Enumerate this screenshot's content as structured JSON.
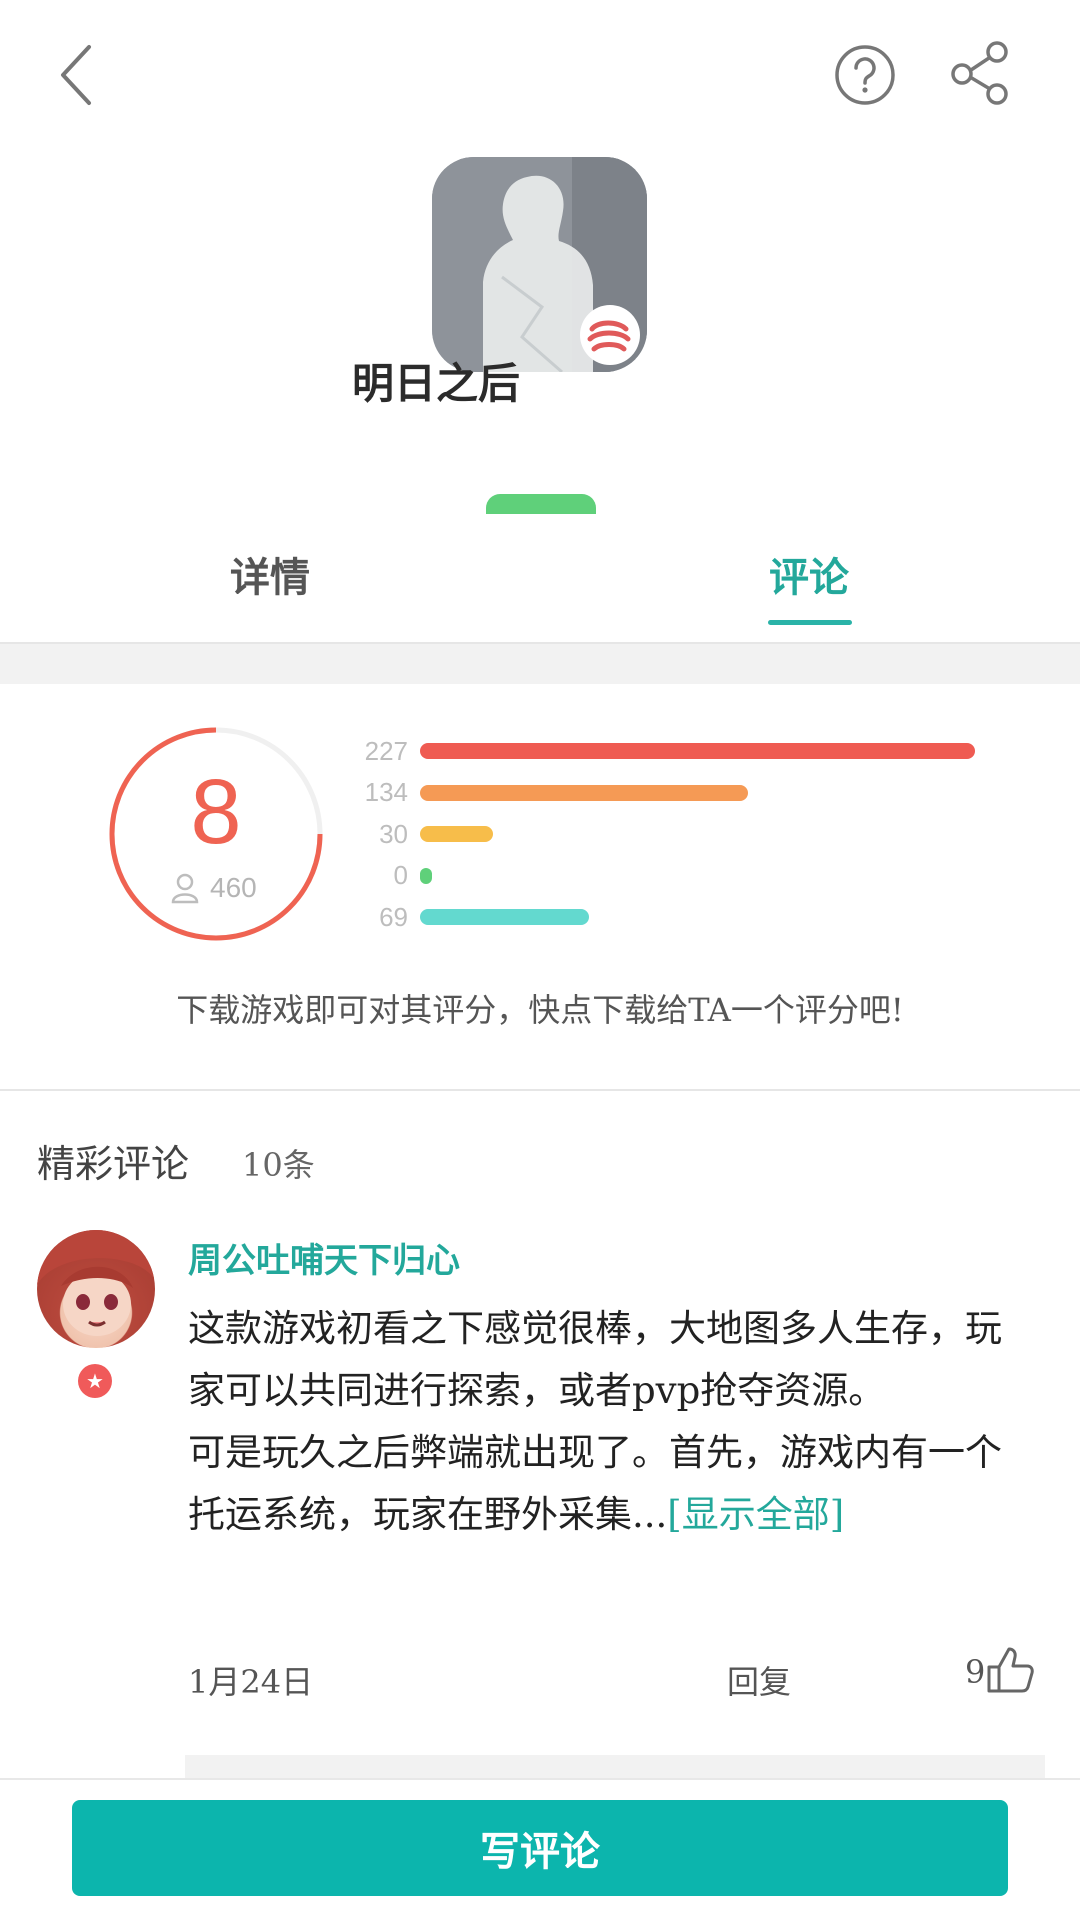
{
  "app": {
    "name": "明日之后"
  },
  "tabs": [
    {
      "label": "详情",
      "active": false
    },
    {
      "label": "评论",
      "active": true
    }
  ],
  "rating": {
    "score": "8",
    "raters": "460",
    "distribution": [
      {
        "count": "227",
        "value": 227,
        "color": "#ef5b52"
      },
      {
        "count": "134",
        "value": 134,
        "color": "#f59a55"
      },
      {
        "count": "30",
        "value": 30,
        "color": "#f7bd4a"
      },
      {
        "count": "0",
        "value": 0,
        "color": "#5fd07a"
      },
      {
        "count": "69",
        "value": 69,
        "color": "#63d9cf"
      }
    ],
    "hint": "下载游戏即可对其评分，快点下载给TA一个评分吧!"
  },
  "comments_section": {
    "title": "精彩评论",
    "count": "10条"
  },
  "comment": {
    "username": "周公吐哺天下归心",
    "paragraph1": "这款游戏初看之下感觉很棒，大地图多人生存，玩家可以共同进行探索，或者pvp抢夺资源。",
    "paragraph2": "可是玩久之后弊端就出现了。首先，游戏内有一个托运系统，玩家在野外采集...",
    "show_all": "[显示全部]",
    "date": "1月24日",
    "reply": "回复",
    "likes": "9"
  },
  "bottom": {
    "write_button": "写评论"
  },
  "colors": {
    "accent": "#0cb5ad",
    "score": "#ef6352"
  }
}
